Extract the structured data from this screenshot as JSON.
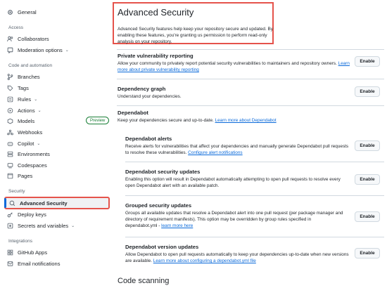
{
  "sidebar": {
    "general": "General",
    "access_label": "Access",
    "collaborators": "Collaborators",
    "moderation": "Moderation options",
    "code_label": "Code and automation",
    "branches": "Branches",
    "tags": "Tags",
    "rules": "Rules",
    "actions": "Actions",
    "models": "Models",
    "models_badge": "Preview",
    "webhooks": "Webhooks",
    "copilot": "Copilot",
    "environments": "Environments",
    "codespaces": "Codespaces",
    "pages": "Pages",
    "security_label": "Security",
    "advanced_security": "Advanced Security",
    "deploy_keys": "Deploy keys",
    "secrets": "Secrets and variables",
    "integrations_label": "Integrations",
    "github_apps": "GitHub Apps",
    "email_notifications": "Email notifications"
  },
  "main": {
    "title": "Advanced Security",
    "description": "Advanced Security features help keep your repository secure and updated. By enabling these features, you're granting us permission to perform read-only analysis on your repository.",
    "enable_label": "Enable",
    "pvr": {
      "title": "Private vulnerability reporting",
      "desc": "Allow your community to privately report potential security vulnerabilities to maintainers and repository owners.",
      "link": "Learn more about private vulnerability reporting"
    },
    "depgraph": {
      "title": "Dependency graph",
      "desc": "Understand your dependencies."
    },
    "dependabot": {
      "title": "Dependabot",
      "desc": "Keep your dependencies secure and up-to-date.",
      "link": "Learn more about Dependabot"
    },
    "alerts": {
      "title": "Dependabot alerts",
      "desc": "Receive alerts for vulnerabilities that affect your dependencies and manually generate Dependabot pull requests to resolve these vulnerabilities.",
      "link": "Configure alert notifications"
    },
    "secupdates": {
      "title": "Dependabot security updates",
      "desc": "Enabling this option will result in Dependabot automatically attempting to open pull requests to resolve every open Dependabot alert with an available patch."
    },
    "grouped": {
      "title": "Grouped security updates",
      "desc": "Groups all available updates that resolve a Dependabot alert into one pull request (per package manager and directory of requirement manifests). This option may be overridden by group rules specified in dependabot.yml -",
      "link": "learn more here"
    },
    "version": {
      "title": "Dependabot version updates",
      "desc": "Allow Dependabot to open pull requests automatically to keep your dependencies up-to-date when new versions are available.",
      "link": "Learn more about configuring a dependabot.yml file"
    },
    "code_scanning": "Code scanning"
  },
  "colors": {
    "accent": "#0969da",
    "highlight": "#e5534b",
    "preview": "#1a7f37"
  }
}
